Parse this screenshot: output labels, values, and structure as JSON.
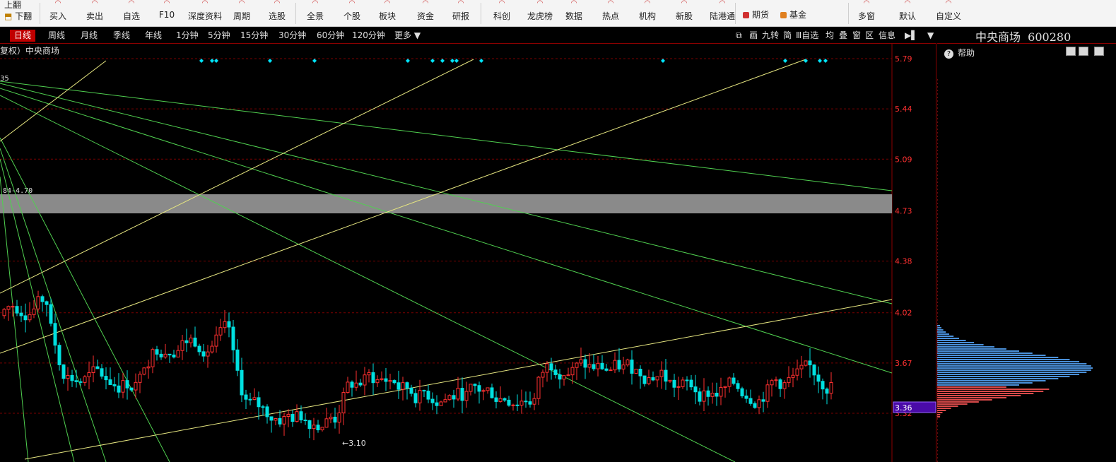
{
  "toolbar": {
    "left_items": [
      {
        "label": "上翻"
      },
      {
        "label": "下翻"
      }
    ],
    "items": [
      {
        "label": "买入",
        "icon": "buy-icon"
      },
      {
        "label": "卖出",
        "icon": "sell-icon"
      },
      {
        "label": "自选",
        "icon": "star-icon"
      },
      {
        "label": "F10",
        "icon": "f10-icon"
      },
      {
        "label": "深度资料",
        "icon": "doc-icon"
      },
      {
        "label": "周期",
        "icon": "cycle-icon"
      },
      {
        "label": "选股",
        "icon": "search-icon"
      },
      {
        "label": "全景",
        "icon": "grid-icon"
      },
      {
        "label": "个股",
        "icon": "candle-icon"
      },
      {
        "label": "板块",
        "icon": "layers-icon"
      },
      {
        "label": "资金",
        "icon": "coin-icon"
      },
      {
        "label": "研报",
        "icon": "report-icon"
      },
      {
        "label": "科创",
        "icon": "chip-icon"
      },
      {
        "label": "龙虎榜",
        "icon": "rank-icon"
      },
      {
        "label": "数据",
        "icon": "data-icon"
      },
      {
        "label": "热点",
        "icon": "fire-icon"
      },
      {
        "label": "机构",
        "icon": "building-icon"
      },
      {
        "label": "新股",
        "icon": "new-icon"
      },
      {
        "label": "陆港通",
        "icon": "hk-icon"
      },
      {
        "label": "多窗",
        "icon": "windows-icon"
      },
      {
        "label": "默认",
        "icon": "default-icon"
      },
      {
        "label": "自定义",
        "icon": "custom-icon"
      }
    ],
    "checks": [
      {
        "label": "期货",
        "color": "#d03030"
      },
      {
        "label": "基金",
        "color": "#e08020"
      }
    ]
  },
  "periods": {
    "tabs": [
      "日线",
      "周线",
      "月线",
      "季线",
      "年线",
      "1分钟",
      "5分钟",
      "15分钟",
      "30分钟",
      "60分钟",
      "120分钟",
      "更多"
    ],
    "active": "日线",
    "more_arrow": "▼"
  },
  "tools": [
    "⧉",
    "画",
    "九转",
    "简",
    "Ⅲ自选",
    "均",
    "叠",
    "窗",
    "区",
    "信息",
    "▶▌",
    "▼"
  ],
  "stock": {
    "name": "中央商场",
    "code": "600280",
    "title_text": "中央商场  600280"
  },
  "chart": {
    "title": "复权）中央商场",
    "left_label_top": "35",
    "band_label": "84-4.70",
    "low_label": "←3.10",
    "price_ticks": [
      "5.79",
      "5.44",
      "5.09",
      "4.73",
      "4.38",
      "4.02",
      "3.67",
      "3.32"
    ],
    "current_price": "3.36",
    "colors": {
      "up": "#ff3030",
      "down": "#00e0e0",
      "grid": "#7a0000",
      "axis": "#ff3030",
      "band": "#8a8a8a",
      "marker": "#00e5ff",
      "current_bg": "#4a0ba8"
    }
  },
  "right_panel": {
    "help_label": "帮助",
    "help_icon": "help-icon",
    "buttons": [
      "list-icon",
      "play-icon",
      "next-icon"
    ]
  }
}
